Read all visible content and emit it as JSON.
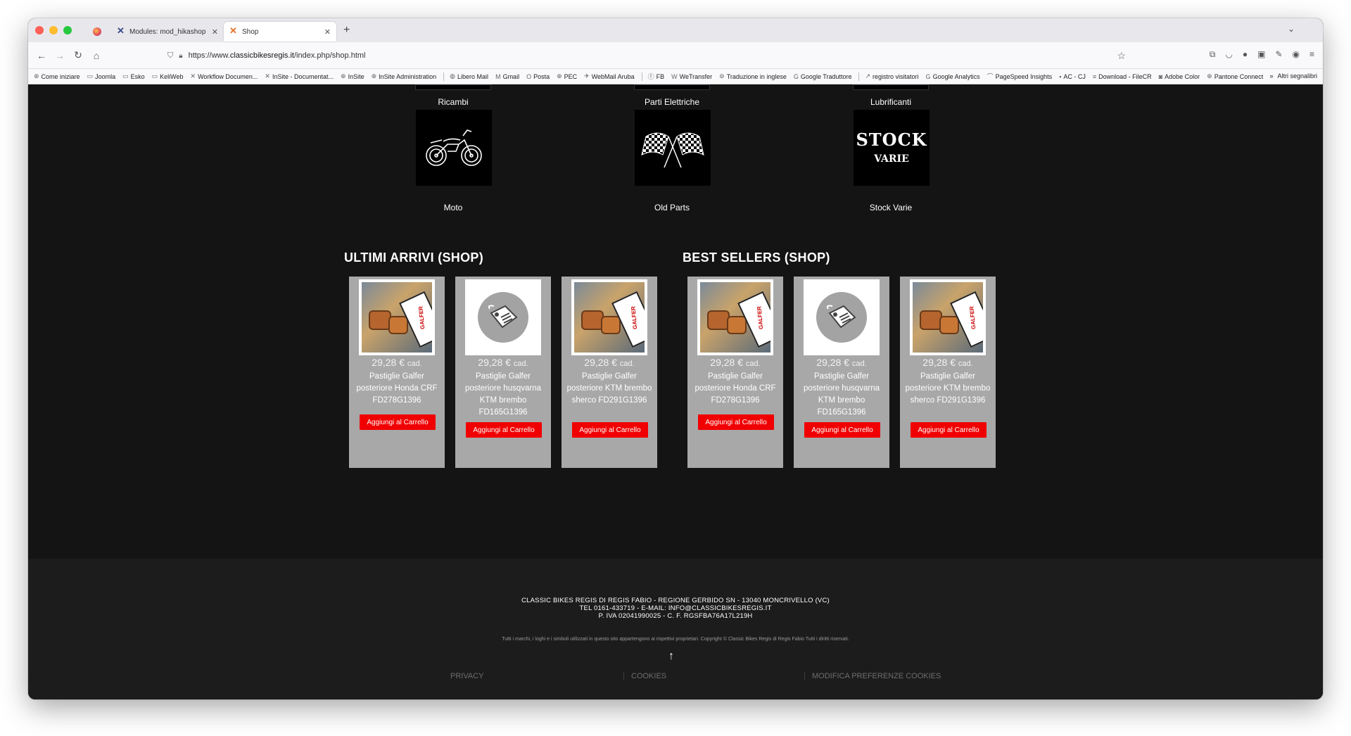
{
  "browser": {
    "tabs": [
      {
        "title": "",
        "pinned": true
      },
      {
        "title": "Modules: mod_hikashop - Classi",
        "active": false
      },
      {
        "title": "Shop",
        "active": true
      }
    ],
    "url_prefix": "https://www.",
    "url_domain": "classicbikesregis.it",
    "url_path": "/index.php/shop.html",
    "bookmarks": [
      "Come iniziare",
      "Joomla",
      "Esko",
      "KeliWeb",
      "Workflow Documen...",
      "InSite - Documentat...",
      "InSite",
      "InSite Administration",
      "Libero Mail",
      "Gmail",
      "Posta",
      "PEC",
      "WebMail Aruba",
      "FB",
      "WeTransfer",
      "Traduzione in inglese",
      "Google Traduttore",
      "registro visitatori",
      "Google Analytics",
      "PageSpeed Insights",
      "AC - CJ",
      "Download - FileCR",
      "Adobe Color",
      "Pantone Connect"
    ],
    "bookmarks_more": "»",
    "other_bookmarks": "Altri segnalibri"
  },
  "categories_top": [
    "Ricambi",
    "Parti Elettriche",
    "Lubrificanti"
  ],
  "categories": [
    {
      "label": "Moto",
      "icon": "motorcycle-icon"
    },
    {
      "label": "Old Parts",
      "icon": "checkered-flags-icon"
    },
    {
      "label": "Stock Varie",
      "icon": "stock-varie-logo",
      "logo_line1": "STOCK",
      "logo_line2": "VARIE"
    }
  ],
  "sections": [
    {
      "title": "ULTIMI ARRIVI (SHOP)",
      "products": [
        {
          "price": "29,28 €",
          "unit": "cad.",
          "name": "Pastiglie Galfer posteriore Honda CRF FD278G1396",
          "image": "galfer",
          "button": "Aggiungi al Carrello"
        },
        {
          "price": "29,28 €",
          "unit": "cad.",
          "name": "Pastiglie Galfer posteriore husqvarna KTM brembo FD165G1396",
          "image": "tag",
          "button": "Aggiungi al Carrello"
        },
        {
          "price": "29,28 €",
          "unit": "cad.",
          "name": "Pastiglie Galfer posteriore KTM brembo sherco FD291G1396",
          "image": "galfer",
          "button": "Aggiungi al Carrello"
        }
      ]
    },
    {
      "title": "BEST SELLERS (SHOP)",
      "products": [
        {
          "price": "29,28 €",
          "unit": "cad.",
          "name": "Pastiglie Galfer posteriore Honda CRF FD278G1396",
          "image": "galfer",
          "button": "Aggiungi al Carrello"
        },
        {
          "price": "29,28 €",
          "unit": "cad.",
          "name": "Pastiglie Galfer posteriore husqvarna KTM brembo FD165G1396",
          "image": "tag",
          "button": "Aggiungi al Carrello"
        },
        {
          "price": "29,28 €",
          "unit": "cad.",
          "name": "Pastiglie Galfer posteriore KTM brembo sherco FD291G1396",
          "image": "galfer",
          "button": "Aggiungi al Carrello"
        }
      ]
    }
  ],
  "footer": {
    "line1": "CLASSIC BIKES REGIS DI REGIS FABIO - REGIONE GERBIDO SN - 13040 MONCRIVELLO (VC)",
    "line2": "TEL 0161-433719 - E-MAIL: INFO@CLASSICBIKESREGIS.IT",
    "line3": "P. IVA 02041990025  -  C. F. RGSFBA76A17L219H",
    "copyright": "Tutti i marchi, i loghi e i simboli utilizzati in questo sito appartengono ai rispettivi proprietari. Copyright © Classic Bikes Regis di Regis Fabio  Tutti i diritti riservati.",
    "links": [
      "PRIVACY",
      "COOKIES",
      "MODIFICA PREFERENZE COOKIES"
    ]
  }
}
